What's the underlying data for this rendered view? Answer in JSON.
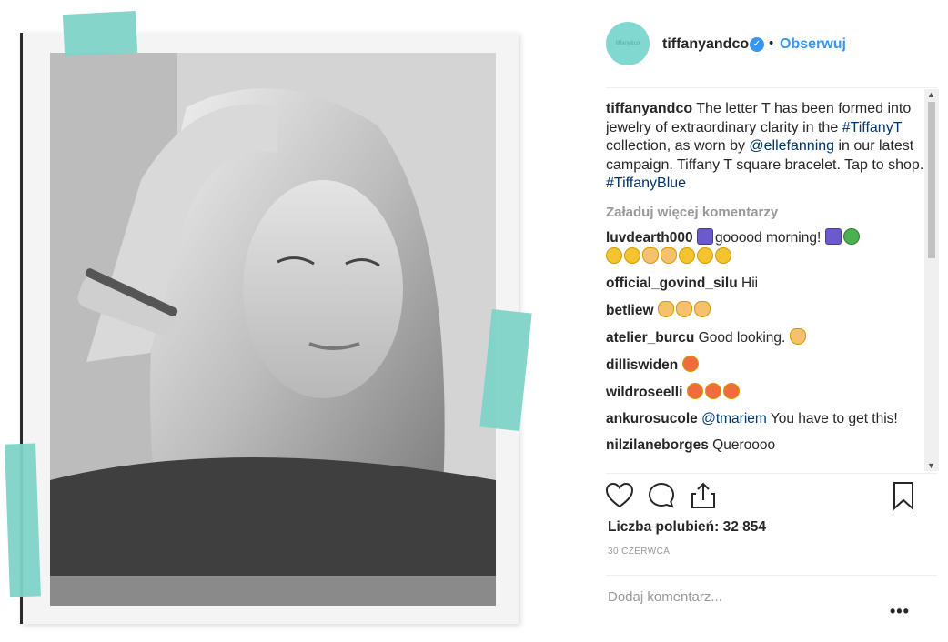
{
  "post": {
    "username": "tiffanyandco",
    "avatar_text": "tiffany&co",
    "follow_label": "Obserwuj",
    "separator": "•",
    "verified_mark": "✓"
  },
  "caption": {
    "username": "tiffanyandco",
    "text_1": " The letter T has been formed into jewelry of extraordinary clarity in the ",
    "tag_1": "#TiffanyT",
    "text_2": " collection, as worn by ",
    "mention_1": "@ellefanning",
    "text_3": " in our latest campaign. Tiffany T square bracelet. Tap to shop. ",
    "tag_2": "#TiffanyBlue"
  },
  "load_more_label": "Załaduj więcej komentarzy",
  "comments": [
    {
      "user": "luvdearth000",
      "text": "gooood morning!"
    },
    {
      "user": "official_govind_silu",
      "text": "Hii"
    },
    {
      "user": "betliew",
      "text": ""
    },
    {
      "user": "atelier_burcu",
      "text": "Good looking."
    },
    {
      "user": "dilliswiden",
      "text": ""
    },
    {
      "user": "wildroseelli",
      "text": ""
    },
    {
      "user": "ankurosucole",
      "mention": "@tmariem",
      "text": " You have to get this!"
    },
    {
      "user": "nilzilaneborges",
      "text": "Queroooo"
    }
  ],
  "likes_label": "Liczba polubień: 32 854",
  "date_label": "30 CZERWCA",
  "add_comment_placeholder": "Dodaj komentarz...",
  "more_label": "•••",
  "scroll_up": "▲",
  "scroll_down": "▼",
  "icons": {
    "like": "heart-icon",
    "comment": "speech-bubble-icon",
    "share": "share-icon",
    "bookmark": "bookmark-icon"
  },
  "colors": {
    "tiffany_blue": "#81d8d0",
    "link_blue": "#3897f0",
    "tag_blue": "#003569",
    "muted": "#999999"
  }
}
